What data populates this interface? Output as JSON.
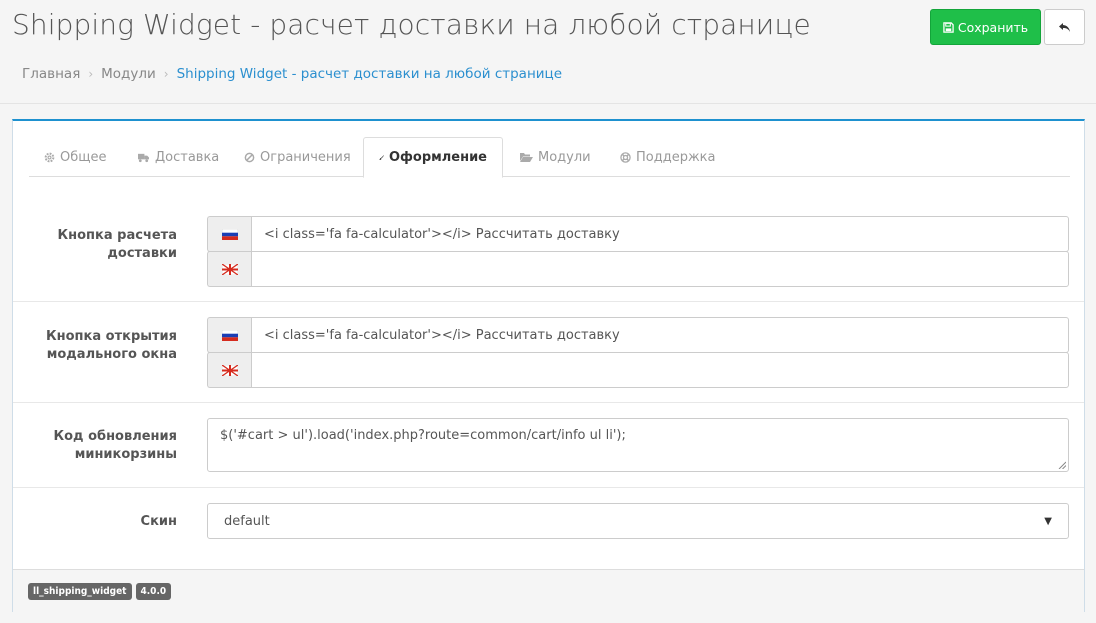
{
  "header": {
    "title": "Shipping Widget - расчет доставки на любой странице",
    "save_label": "Сохранить"
  },
  "breadcrumb": [
    {
      "label": "Главная"
    },
    {
      "label": "Модули"
    },
    {
      "label": "Shipping Widget - расчет доставки на любой странице"
    }
  ],
  "tabs": [
    {
      "label": "Общее",
      "icon": "cog-icon"
    },
    {
      "label": "Доставка",
      "icon": "truck-icon"
    },
    {
      "label": "Ограничения",
      "icon": "ban-icon"
    },
    {
      "label": "Оформление",
      "icon": "paint-brush-icon",
      "active": true
    },
    {
      "label": "Модули",
      "icon": "folder-open-icon"
    },
    {
      "label": "Поддержка",
      "icon": "life-ring-icon"
    }
  ],
  "form": {
    "calc_button": {
      "label_line1": "Кнопка расчета",
      "label_line2": "доставки",
      "ru_value": "<i class='fa fa-calculator'></i> Рассчитать доставку",
      "en_value": ""
    },
    "modal_button": {
      "label_line1": "Кнопка открытия",
      "label_line2": "модального окна",
      "ru_value": "<i class='fa fa-calculator'></i> Рассчитать доставку",
      "en_value": ""
    },
    "minicart_code": {
      "label_line1": "Код обновления",
      "label_line2": "миникорзины",
      "value": "$('#cart > ul').load('index.php?route=common/cart/info ul li');"
    },
    "skin": {
      "label": "Скин",
      "value": "default"
    }
  },
  "footer": {
    "module_code": "ll_shipping_widget",
    "version": "4.0.0"
  },
  "colors": {
    "save_button": "#1fbf49",
    "link_blue": "#2b8fcf",
    "panel_top": "#1e91cf"
  }
}
